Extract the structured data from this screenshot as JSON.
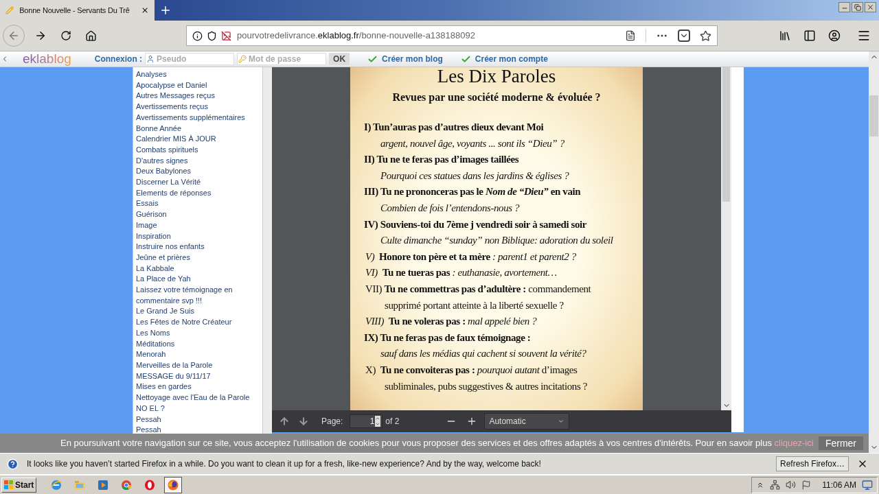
{
  "browser": {
    "tab": {
      "title": "Bonne Nouvelle - Servants Du Trê",
      "selected": true
    },
    "url": {
      "subdomain": "pourvotredelivrance.",
      "domain": "eklablog.fr",
      "path": "/bonne-nouvelle-a138188092"
    }
  },
  "site_bar": {
    "logo": "eklablog",
    "login_label": "Connexion :",
    "pseudo_placeholder": "Pseudo",
    "password_placeholder": "Mot de passe",
    "ok_button": "OK",
    "links": [
      "Créer mon blog",
      "Créer mon compte"
    ]
  },
  "sidebar": {
    "items": [
      "Analyses",
      "Apocalypse et Daniel",
      "Autres Messages reçus",
      "Avertissements reçus",
      "Avertissements supplémentaires",
      "Bonne Année",
      "Calendrier MIS À JOUR",
      "Combats spirituels",
      "D'autres signes",
      "Deux Babylones",
      "Discerner La Vérité",
      "Elements de réponses",
      "Essais",
      "Guérison",
      "Image",
      "Inspiration",
      "Instruire nos enfants",
      "Jeûne et prières",
      "La Kabbale",
      "La Place de Yah",
      "Laissez votre témoignage en commentaire svp !!!",
      "Le Grand Je Suis",
      "Les Fêtes de Notre Créateur",
      "Les Noms",
      "Méditations",
      "Menorah",
      "Merveilles de la Parole",
      "MESSAGE du 9/11/17",
      "Mises en gardes",
      "Nettoyage avec l'Eau de la Parole",
      "NO EL ?",
      "Pessah",
      "Pessah"
    ]
  },
  "document": {
    "title": "Les Dix Paroles",
    "subtitle": "Revues par une société moderne & évoluée ?",
    "lines": [
      {
        "kind": "command",
        "text": "I) Tun’auras pas d’autres dieux devant Moi"
      },
      {
        "kind": "gloss",
        "text": "argent, nouvel âge, voyants ... sont ils “Dieu” ?"
      },
      {
        "kind": "command",
        "text": "II) Tu ne te feras pas d’images taillées"
      },
      {
        "kind": "gloss",
        "text": "Pourquoi ces statues dans les jardins & églises ?"
      },
      {
        "kind": "command",
        "text": "III) Tu ne prononceras pas le *Nom de “Dieu”* en vain"
      },
      {
        "kind": "gloss",
        "text": "Combien de fois l’entendons-nous ?"
      },
      {
        "kind": "command",
        "text": "IV) Souviens-toi du 7ème j vendredi soir à samedi soir"
      },
      {
        "kind": "gloss",
        "text": "Culte dimanche “sunday” non Biblique: adoration du soleil"
      },
      {
        "kind": "mixed",
        "text": "*V)*  **Honore ton père et ta mère** *: parent1 et parent2 ?*"
      },
      {
        "kind": "mixed",
        "text": "*VI)*  **Tu ne tueras pas** *: euthanasie, avortement…*"
      },
      {
        "kind": "mixed",
        "text": "VII) **Tu ne commettras pas d’adultère :** commandement"
      },
      {
        "kind": "continuation",
        "text": "supprimé portant atteinte à la liberté sexuelle ?"
      },
      {
        "kind": "mixed",
        "text": "*VIII)*  **Tu ne voleras pas :** *mal appelé bien ?*"
      },
      {
        "kind": "command",
        "text": "IX) Tu ne feras pas de faux témoignage :"
      },
      {
        "kind": "gloss",
        "text": "sauf dans les médias qui cachent si souvent la vérité?"
      },
      {
        "kind": "mixed",
        "text": "X)  **Tu ne convoiteras pas :** *pourquoi autant* d’images"
      },
      {
        "kind": "continuation",
        "text": "subliminales, pubs suggestives & autres incitations ?"
      }
    ]
  },
  "viewer_toolbar": {
    "page_label": "Page:",
    "page_value": "1",
    "page_count": "of 2",
    "zoom": "Automatic"
  },
  "cookie_banner": {
    "text": "En poursuivant votre navigation sur ce site, vous acceptez l'utilisation de cookies pour vous proposer des services et des offres adaptés à vos centres d'intérêts. Pour en savoir plus",
    "link": "cliquez-ici",
    "close_button": "Fermer"
  },
  "notification": {
    "text": "It looks like you haven’t started Firefox in a while. Do you want to clean it up for a fresh, like-new experience? And by the way, welcome back!",
    "button": "Refresh Firefox…"
  },
  "taskbar": {
    "start": "Start",
    "apps": [
      {
        "kind": "ie",
        "selected": false
      },
      {
        "kind": "explorer",
        "selected": false
      },
      {
        "kind": "media",
        "selected": false
      },
      {
        "kind": "chrome",
        "selected": false
      },
      {
        "kind": "opera",
        "selected": false
      },
      {
        "kind": "firefox",
        "selected": true
      }
    ],
    "clock": "11:06 AM"
  }
}
